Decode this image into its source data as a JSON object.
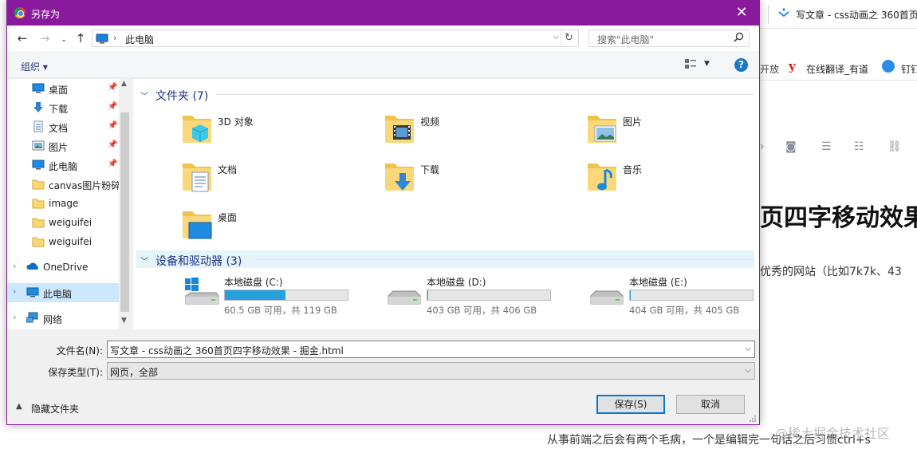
{
  "background": {
    "tab_title": "写文章 - css动画之 360首页",
    "bookmark_cut": "开放",
    "bookmark_youdao_letter": "y",
    "bookmark_youdao": "在线翻译_有道",
    "bookmark_dingtalk": "钉钉",
    "article_heading": "页四字移动效果",
    "article_paragraph": "优秀的网站（比如7k7k、43",
    "article_paragraph_2": "从事前端之后会有两个毛病，一个是编辑完一句话之后习惯ctrl+s",
    "watermark": "@稀土掘金技术社区"
  },
  "dialog": {
    "title": "另存为",
    "close_glyph": "✕",
    "address": {
      "path": "此电脑",
      "search_placeholder": "搜索\"此电脑\""
    },
    "toolbar": {
      "organize": "组织 ▾",
      "help": "?"
    },
    "nav": {
      "items": [
        {
          "label": "桌面",
          "icon": "desktop-icon",
          "pinned": true
        },
        {
          "label": "下载",
          "icon": "download-icon",
          "pinned": true
        },
        {
          "label": "文档",
          "icon": "document-icon",
          "pinned": true
        },
        {
          "label": "图片",
          "icon": "pictures-icon",
          "pinned": true
        },
        {
          "label": "此电脑",
          "icon": "computer-icon",
          "pinned": true
        },
        {
          "label": "canvas图片粉碎",
          "icon": "folder-icon",
          "pinned": false
        },
        {
          "label": "image",
          "icon": "folder-icon",
          "pinned": false
        },
        {
          "label": "weiguifei",
          "icon": "folder-icon",
          "pinned": false
        },
        {
          "label": "weiguifei",
          "icon": "folder-icon",
          "pinned": false
        },
        {
          "label": "OneDrive",
          "icon": "onedrive-icon",
          "pinned": false
        },
        {
          "label": "此电脑",
          "icon": "computer-icon",
          "pinned": false
        },
        {
          "label": "网络",
          "icon": "network-icon",
          "pinned": false
        }
      ]
    },
    "folders_group": {
      "label": "文件夹 (7)",
      "items": [
        {
          "name": "3D 对象",
          "icon": "3d-objects-icon"
        },
        {
          "name": "视频",
          "icon": "videos-icon"
        },
        {
          "name": "图片",
          "icon": "pictures-icon"
        },
        {
          "name": "文档",
          "icon": "documents-icon"
        },
        {
          "name": "下载",
          "icon": "downloads-icon"
        },
        {
          "name": "音乐",
          "icon": "music-icon"
        },
        {
          "name": "桌面",
          "icon": "desktop-icon"
        }
      ]
    },
    "drives_group": {
      "label": "设备和驱动器 (3)",
      "items": [
        {
          "name": "本地磁盘 (C:)",
          "info": "60.5 GB 可用，共 119 GB",
          "used_fraction": 0.492,
          "icon": "windows-drive-icon"
        },
        {
          "name": "本地磁盘 (D:)",
          "info": "403 GB 可用，共 406 GB",
          "used_fraction": 0.007,
          "icon": "hard-drive-icon"
        },
        {
          "name": "本地磁盘 (E:)",
          "info": "404 GB 可用，共 405 GB",
          "used_fraction": 0.002,
          "icon": "hard-drive-icon"
        }
      ]
    },
    "form": {
      "filename_label": "文件名(N):",
      "filename_value": "写文章 - css动画之 360首页四字移动效果 - 掘金.html",
      "filetype_label": "保存类型(T):",
      "filetype_value": "网页，全部"
    },
    "hide_folders": "隐藏文件夹",
    "save_button": "保存(S)",
    "cancel_button": "取消"
  },
  "colors": {
    "titlebar": "#8a1a9c",
    "selection": "#cce8ff",
    "drive_bar": "#26a0da",
    "group_heading": "#1e3287"
  }
}
